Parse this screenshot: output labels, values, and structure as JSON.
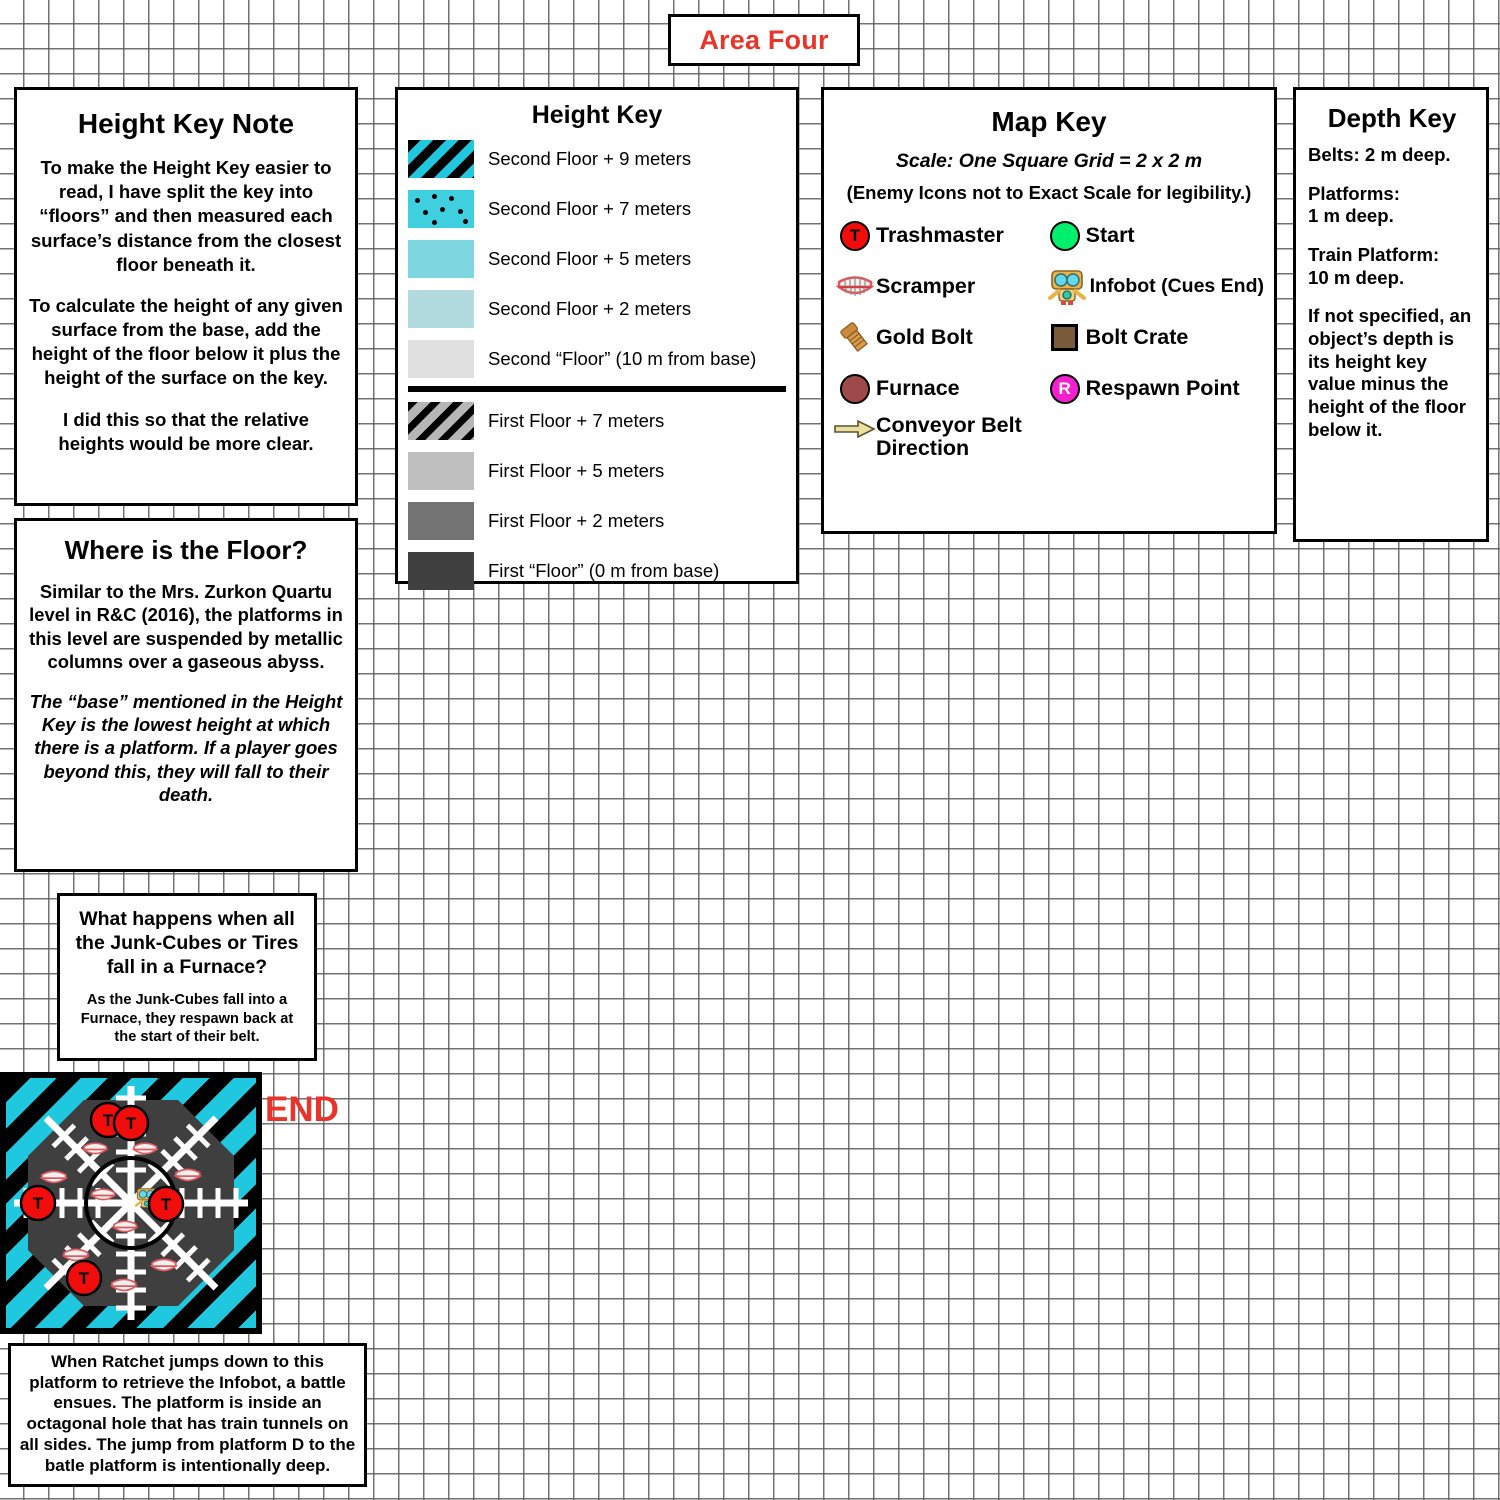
{
  "title": {
    "text": "Area Four",
    "color": "#e8342a"
  },
  "height_key_note": {
    "title": "Height Key Note",
    "paragraphs": [
      "To make the Height Key easier to read, I have split the key into “floors” and then measured each surface’s distance from the closest floor beneath it.",
      "To calculate the height of any given surface from the base, add the height of the floor below it plus the height of the surface on the key.",
      "I did this so that the relative heights would be more clear."
    ]
  },
  "where_is_the_floor": {
    "title": "Where is the Floor?",
    "paragraph": "Similar to the Mrs. Zurkon Quartu level in R&C (2016), the platforms in this level are suspended by metallic columns over a gaseous abyss.",
    "paragraph_italic": "The “base” mentioned in the Height Key is the lowest height at which there is a platform. If a player goes beyond this, they will fall to their death."
  },
  "junk_cube_note": {
    "title": "What happens when all the Junk-Cubes or Tires fall in a Furnace?",
    "body": "As the Junk-Cubes fall into a Furnace, they respawn back at the start of their belt."
  },
  "platform_caption": {
    "text": "When Ratchet jumps down to this platform to retrieve the Infobot, a battle ensues. The platform is inside an octagonal hole that has train tunnels on all sides. The jump from platform D to the batle platform is intentionally deep."
  },
  "height_key": {
    "title": "Height Key",
    "second_floor": [
      {
        "label": "Second Floor + 9 meters",
        "swatch": "diagonal-stripe-cyan-black",
        "color": "#1fc8de"
      },
      {
        "label": "Second Floor + 7 meters",
        "swatch": "dotted-cyan",
        "color": "#3fd0e0"
      },
      {
        "label": "Second Floor + 5 meters",
        "swatch": "solid",
        "color": "#7ed7e0"
      },
      {
        "label": "Second Floor + 2 meters",
        "swatch": "solid",
        "color": "#b2dbdf"
      },
      {
        "label": "Second “Floor” (10 m from base)",
        "swatch": "solid",
        "color": "#e0e0e0"
      }
    ],
    "first_floor": [
      {
        "label": "First Floor + 7 meters",
        "swatch": "diagonal-stripe-gray-black",
        "color": "#b6b6b6"
      },
      {
        "label": "First Floor + 5 meters",
        "swatch": "solid",
        "color": "#bfbfbf"
      },
      {
        "label": "First Floor + 2 meters",
        "swatch": "solid",
        "color": "#737373"
      },
      {
        "label": "First “Floor” (0 m from base)",
        "swatch": "solid",
        "color": "#404040"
      }
    ]
  },
  "map_key": {
    "title": "Map Key",
    "scale": "Scale: One Square Grid = 2 x 2 m",
    "note": "(Enemy Icons not to Exact Scale for legibility.)",
    "left_items": [
      {
        "label": "Trashmaster",
        "icon": "trashmaster-icon",
        "color": "#f20d0d",
        "glyph": "T"
      },
      {
        "label": "Scramper",
        "icon": "scramper-teeth-icon",
        "color": "#e8555a",
        "glyph": "🦷"
      },
      {
        "label": "Gold Bolt",
        "icon": "gold-bolt-icon",
        "color": "#b5762c",
        "glyph": "🔩"
      },
      {
        "label": "Furnace",
        "icon": "furnace-icon",
        "color": "#9e4a4a",
        "glyph": ""
      },
      {
        "label": "Conveyor Belt Direction",
        "icon": "conveyor-arrow-icon",
        "color": "#ece0a0",
        "glyph": "➡"
      }
    ],
    "right_items": [
      {
        "label": "Start",
        "icon": "start-icon",
        "color": "#00ef6c",
        "glyph": ""
      },
      {
        "label": "Infobot (Cues End)",
        "icon": "infobot-icon",
        "color": "#e8b44a",
        "glyph": ""
      },
      {
        "label": "Bolt Crate",
        "icon": "bolt-crate-icon",
        "color": "#7a5c3c",
        "glyph": ""
      },
      {
        "label": "Respawn Point",
        "icon": "respawn-point-icon",
        "color": "#f51fd0",
        "glyph": "R"
      }
    ]
  },
  "depth_key": {
    "title": "Depth Key",
    "lines": [
      "Belts: 2 m deep.",
      "Platforms:\n1 m deep.",
      "Train Platform:\n10 m deep.",
      "If not specified, an object’s depth is its height key value minus the height of the floor below it."
    ]
  },
  "map": {
    "end_label": "END",
    "battle_platform": {
      "trashmaster_glyph": "T",
      "hazard_color": "#1fc8de",
      "floor_color": "#3f3f3f"
    }
  }
}
